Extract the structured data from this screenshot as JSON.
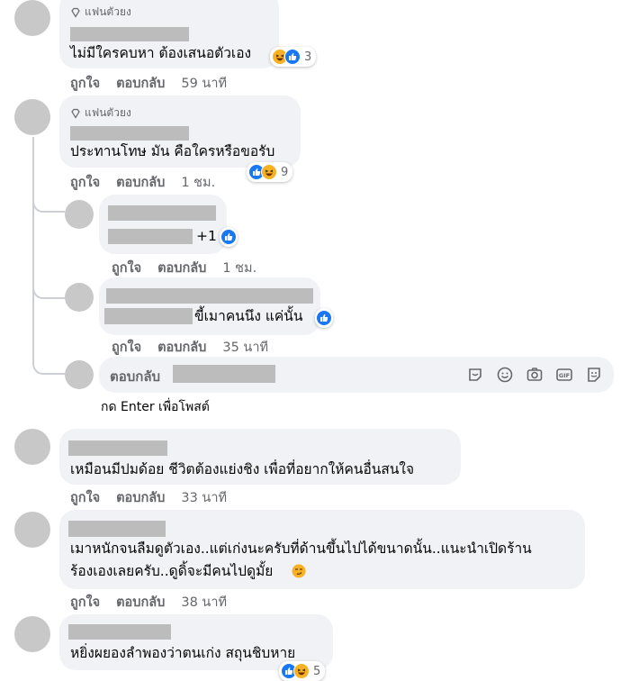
{
  "labels": {
    "like": "ถูกใจ",
    "reply": "ตอบกลับ",
    "fan_badge": "แฟนตัวยง"
  },
  "comments": [
    {
      "text": "ไม่มีใครคบหา ต้องเสนอตัวเอง",
      "time": "59 นาที",
      "reaction_count": "3"
    },
    {
      "text": "ประทานโทษ มัน คือใครหรือขอรับ",
      "time": "1 ชม.",
      "reaction_count": "9"
    },
    {
      "text": "+1",
      "time": "1 ชม."
    },
    {
      "text": "ขี้เมาคนนึง แค่นั้น",
      "time": "35 นาที"
    },
    {
      "text": "เหมือนมีปมด้อย ชีวิตต้องแย่งชิง เพื่อที่อยากให้คนอื่นสนใจ",
      "time": "33 นาที"
    },
    {
      "text_line1": "เมาหนักจนลืมดูตัวเอง..แต่เก่งนะครับที่ด้านขึ้นไปได้ขนาดนั้น..แนะนำเปิดร้าน",
      "text_line2": "ร้องเองเลยครับ..ดูดิ้จะมีคนไปดูมั้ย",
      "time": "38 นาที"
    },
    {
      "text": "หยิ่งผยองลำพองว่าตนเก่ง สถุนชิบหาย",
      "reaction_count": "5"
    }
  ],
  "reply_box": {
    "placeholder": "ตอบกลับ",
    "hint": "กด Enter เพื่อโพสต์",
    "icons": [
      "sticker-icon",
      "emoji-icon",
      "camera-icon",
      "gif-icon",
      "avatar-sticker-icon"
    ]
  },
  "colors": {
    "like_blue": "#1877f2",
    "haha_yellow": "#f7b125",
    "bubble_bg": "#f0f2f5",
    "meta_grey": "#65676b"
  }
}
